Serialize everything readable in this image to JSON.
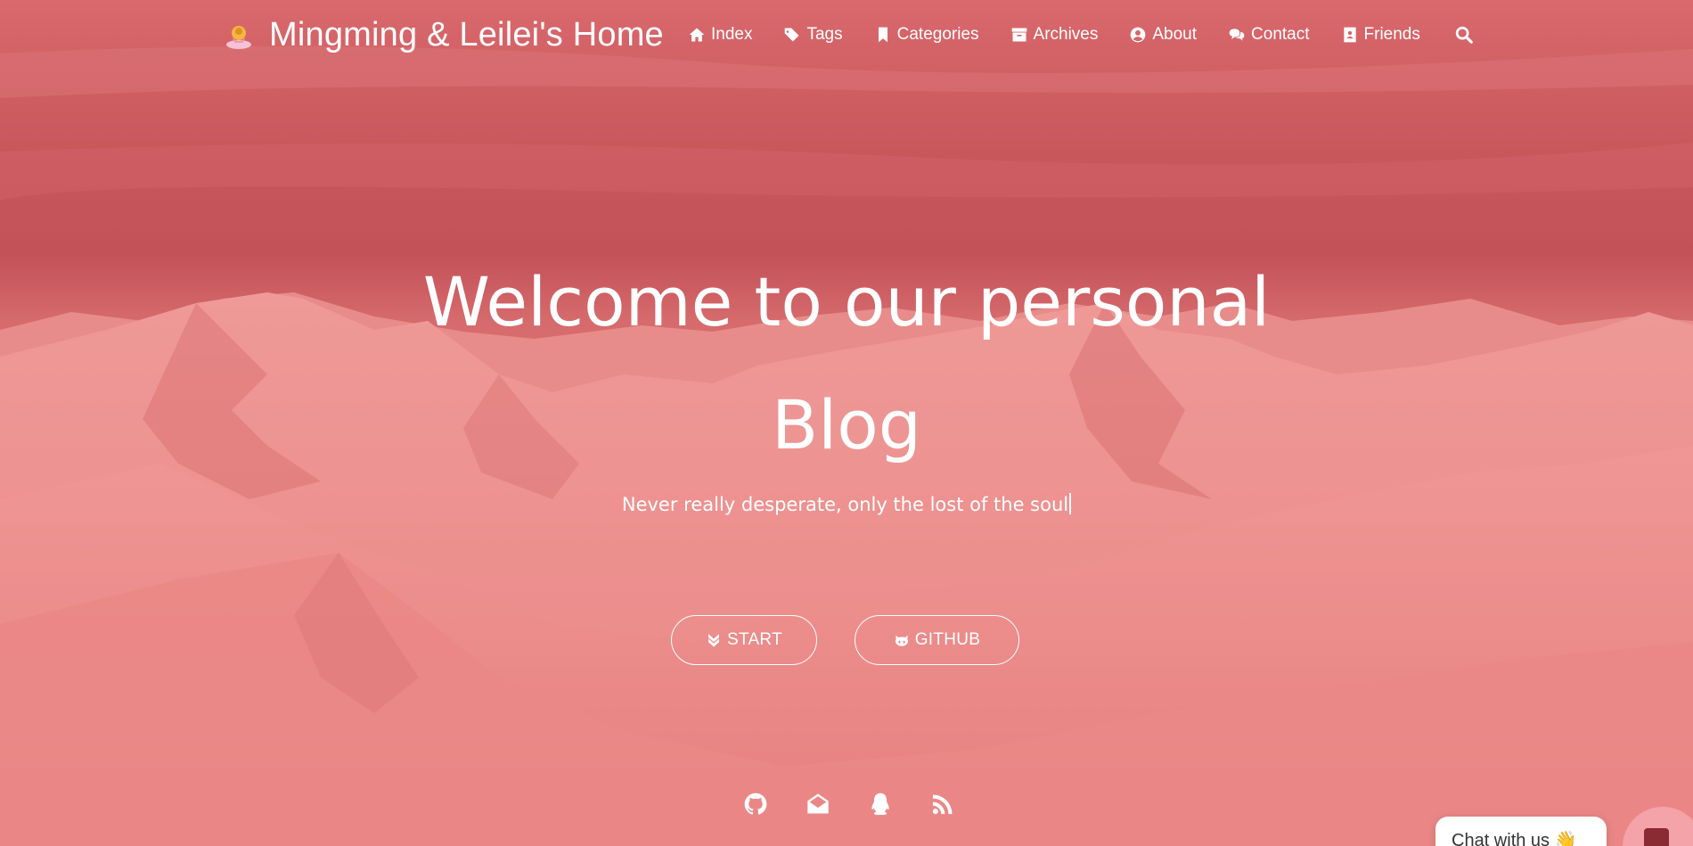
{
  "header": {
    "brand_title": "Mingming & Leilei's Home",
    "nav": [
      {
        "label": "Index",
        "icon": "home-icon"
      },
      {
        "label": "Tags",
        "icon": "tags-icon"
      },
      {
        "label": "Categories",
        "icon": "bookmark-icon"
      },
      {
        "label": "Archives",
        "icon": "archive-icon"
      },
      {
        "label": "About",
        "icon": "user-circle-icon"
      },
      {
        "label": "Contact",
        "icon": "comments-icon"
      },
      {
        "label": "Friends",
        "icon": "address-book-icon"
      }
    ],
    "search_icon": "search-icon"
  },
  "hero": {
    "headline_line1": "Welcome to our personal",
    "headline_line2": "Blog",
    "subtitle": "Never really desperate, only the lost of the soul",
    "start_label": "START",
    "github_label": "GITHUB"
  },
  "social": [
    "github-icon",
    "envelope-icon",
    "qq-icon",
    "rss-icon"
  ],
  "chat": {
    "label": "Chat with us 👋"
  },
  "colors": {
    "accent": "#e27575",
    "text": "#ffffff"
  }
}
